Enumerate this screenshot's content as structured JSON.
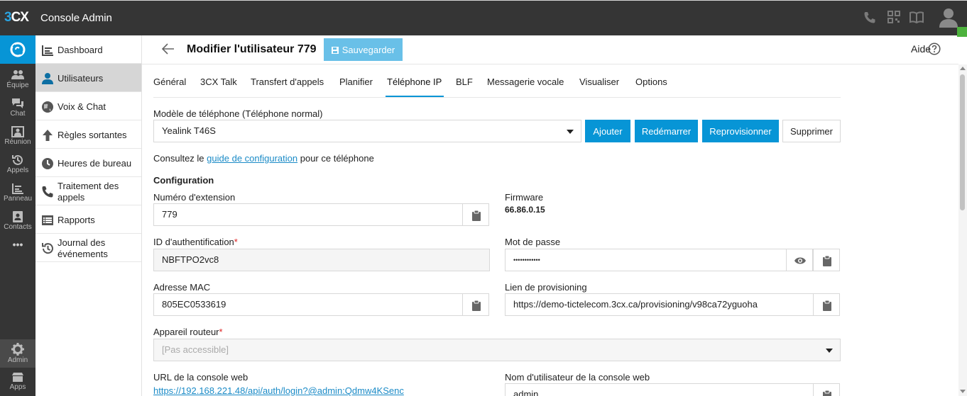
{
  "app": {
    "logo_prefix": "3",
    "logo_suffix": "CX",
    "title": "Console Admin"
  },
  "rail": {
    "items": [
      {
        "label": "Équipe",
        "icon": "team-icon"
      },
      {
        "label": "Chat",
        "icon": "chat-icon"
      },
      {
        "label": "Réunion",
        "icon": "meeting-icon"
      },
      {
        "label": "Appels",
        "icon": "calls-history-icon"
      },
      {
        "label": "Panneau",
        "icon": "panel-icon"
      },
      {
        "label": "Contacts",
        "icon": "contacts-icon"
      },
      {
        "label": "•••",
        "icon": "more-icon"
      }
    ],
    "admin": "Admin",
    "apps": "Apps"
  },
  "submenu": {
    "items": [
      {
        "label": "Dashboard",
        "icon": "dashboard-icon"
      },
      {
        "label": "Utilisateurs",
        "icon": "user-icon",
        "active": true
      },
      {
        "label": "Voix & Chat",
        "icon": "globe-icon"
      },
      {
        "label": "Règles sortantes",
        "icon": "arrow-up-icon"
      },
      {
        "label": "Heures de bureau",
        "icon": "clock-icon"
      },
      {
        "label": "Traitement des appels",
        "icon": "phone-icon"
      },
      {
        "label": "Rapports",
        "icon": "report-icon"
      },
      {
        "label": "Journal des événements",
        "icon": "history-icon"
      }
    ]
  },
  "header": {
    "title": "Modifier l'utilisateur 779",
    "save_label": "Sauvegarder",
    "help_label": "Aide"
  },
  "tabs": [
    "Général",
    "3CX Talk",
    "Transfert d'appels",
    "Planifier",
    "Téléphone IP",
    "BLF",
    "Messagerie vocale",
    "Visualiser",
    "Options"
  ],
  "active_tab": "Téléphone IP",
  "phone": {
    "model_label": "Modèle de téléphone (Téléphone normal)",
    "model_value": "Yealink T46S",
    "buttons": {
      "add": "Ajouter",
      "reboot": "Redémarrer",
      "reprovision": "Reprovisionner",
      "delete": "Supprimer"
    },
    "consult_prefix": "Consultez le",
    "consult_link": "guide de configuration",
    "consult_suffix": "pour ce téléphone"
  },
  "config": {
    "section_title": "Configuration",
    "extension_label": "Numéro d'extension",
    "extension_value": "779",
    "firmware_label": "Firmware",
    "firmware_value": "66.86.0.15",
    "auth_label": "ID d'authentification",
    "auth_value": "NBFTPO2vc8",
    "password_label": "Mot de passe",
    "password_value": "••••••••••••",
    "mac_label": "Adresse MAC",
    "mac_value": "805EC0533619",
    "prov_label": "Lien de provisioning",
    "prov_value": "https://demo-tictelecom.3cx.ca/provisioning/v98ca72yguoha",
    "router_label": "Appareil routeur",
    "router_value": "[Pas accessible]",
    "webconsole_url_label": "URL de la console web",
    "webconsole_url_value": "https://192.168.221.48/api/auth/login?@admin:Qdmw4KSenc",
    "webconsole_user_label": "Nom d'utilisateur de la console web",
    "webconsole_user_value": "admin"
  },
  "colors": {
    "topbar": "#353535",
    "accent": "#0795d6",
    "status": "#4db23d"
  }
}
